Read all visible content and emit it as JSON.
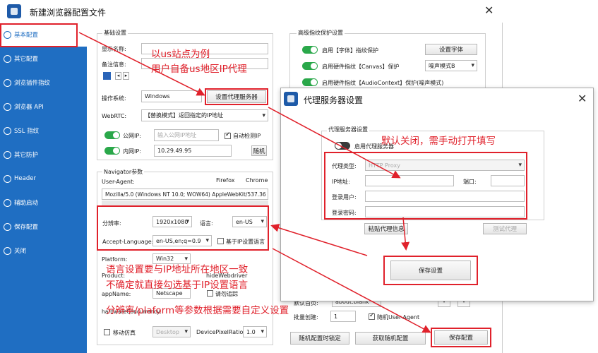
{
  "window": {
    "title": "新建浏览器配置文件",
    "close": "✕"
  },
  "sidebar": {
    "items": [
      {
        "label": "基本配置"
      },
      {
        "label": "其它配置"
      },
      {
        "label": "浏览插件指纹"
      },
      {
        "label": "浏览器 API"
      },
      {
        "label": "SSL 指纹"
      },
      {
        "label": "其它防护"
      },
      {
        "label": "Header"
      },
      {
        "label": "辅助启动"
      },
      {
        "label": "保存配置"
      },
      {
        "label": "关闭"
      }
    ]
  },
  "basic": {
    "group": "基础设置",
    "display_name": "显示名称:",
    "note": "备注信息:",
    "os_label": "操作系统:",
    "os_value": "Windows",
    "proxy_btn": "设置代理服务器",
    "webrtc_label": "WebRTC:",
    "webrtc_value": "【替换模式】返回指定的IP地址",
    "public_ip": "公网IP:",
    "public_ip_ph": "输入公网IP地址",
    "auto_detect": "自动检测IP",
    "lan_ip": "内网IP:",
    "lan_ip_value": "10.29.49.95",
    "random": "随机"
  },
  "navigator": {
    "group": "Navigator参数",
    "ua_label": "User-Agent:",
    "firefox": "Firefox",
    "chrome": "Chrome",
    "ua_value": "Mozilla/5.0 (Windows NT 10.0; WOW64) AppleWebKit/537.36 (KHT",
    "res_label": "分辨率:",
    "res_value": "1920x1080",
    "lang_label": "语言:",
    "lang_value": "en-US",
    "al_label": "Accept-Language:",
    "al_value": "en-US,en;q=0.9",
    "ip_lang": "基于IP设置语言",
    "platform_label": "Platform:",
    "platform_value": "Win32",
    "product_label": "Product:",
    "webdriver": "hideWebdriver",
    "appname_label": "appName:",
    "appname_value": "Netscape",
    "dnt": "请勿追踪",
    "hwc_label": "hardwareConcurrency:",
    "mobile": "移动仿真",
    "mobile_value": "Desktop",
    "dpr_label": "DevicePixelRatio:",
    "dpr_value": "1.0"
  },
  "advanced": {
    "group": "高级指纹保护设置",
    "font": "启用【字体】指纹保护",
    "font_btn": "设置字体",
    "canvas": "启用硬件指纹【Canvas】保护",
    "canvas_value": "噪声模式B",
    "audio": "启用硬件指纹【AudioContext】保护(噪声模式)",
    "home_label": "默认首页:",
    "home_value": "about:blank",
    "batch_label": "批量创建:",
    "batch_value": "1",
    "random_ua": "随机User-Agent"
  },
  "footer": {
    "lock": "随机配置时锁定",
    "get_random": "获取随机配置",
    "save": "保存配置"
  },
  "dialog": {
    "title": "代理服务器设置",
    "group": "代理服务器设置",
    "enable": "启用代理服务器",
    "type_label": "代理类型:",
    "type_value": "HTTP Proxy",
    "ip_label": "IP地址:",
    "port_label": "端口:",
    "user_label": "登录用户:",
    "pass_label": "登录密码:",
    "paste_btn": "粘贴代理信息",
    "test_btn": "测试代理",
    "save_btn": "保存设置"
  },
  "annotations": {
    "a1_line1": "以us站点为例",
    "a1_line2": "用户自备us地区IP代理",
    "a2": "默认关闭，需手动打开填写",
    "a3_line1": "语言设置要与IP地址所在地区一致",
    "a3_line2": "不确定就直接勾选基于IP设置语言",
    "a4": "分辨率/plaform等参数根据需要自定义设置"
  },
  "colors": {
    "accent": "#1f6ec2",
    "annotation_red": "#e0212b",
    "toggle_on": "#2aa84a"
  }
}
